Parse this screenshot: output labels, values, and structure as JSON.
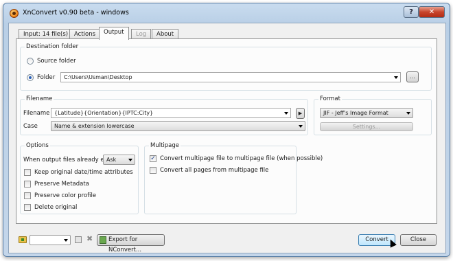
{
  "window": {
    "title": "XnConvert v0.90 beta - windows",
    "help": "?",
    "close": "✕"
  },
  "tabs": [
    {
      "label": "Input: 14 file(s)"
    },
    {
      "label": "Actions"
    },
    {
      "label": "Output"
    },
    {
      "label": "Log"
    },
    {
      "label": "About"
    }
  ],
  "destination": {
    "title": "Destination folder",
    "source_label": "Source folder",
    "folder_label": "Folder",
    "folder_value": "C:\\Users\\Usman\\Desktop",
    "browse": "..."
  },
  "filename": {
    "title": "Filename",
    "filename_label": "Filename",
    "filename_value": "{Latitude}{Orientation}{IPTC:City}",
    "case_label": "Case",
    "case_value": "Name & extension lowercase"
  },
  "format": {
    "title": "Format",
    "value": "JIF - Jeff's Image Format",
    "settings": "Settings..."
  },
  "options": {
    "title": "Options",
    "exists_label": "When output files already exist",
    "exists_value": "Ask",
    "keep_date": "Keep original date/time attributes",
    "preserve_meta": "Preserve Metadata",
    "preserve_color": "Preserve color profile",
    "delete_original": "Delete original"
  },
  "multipage": {
    "title": "Multipage",
    "convert_multi": "Convert multipage file to multipage file (when possible)",
    "convert_all": "Convert all pages from multipage file"
  },
  "footer": {
    "export": "Export for NConvert...",
    "convert": "Convert",
    "close": "Close"
  }
}
